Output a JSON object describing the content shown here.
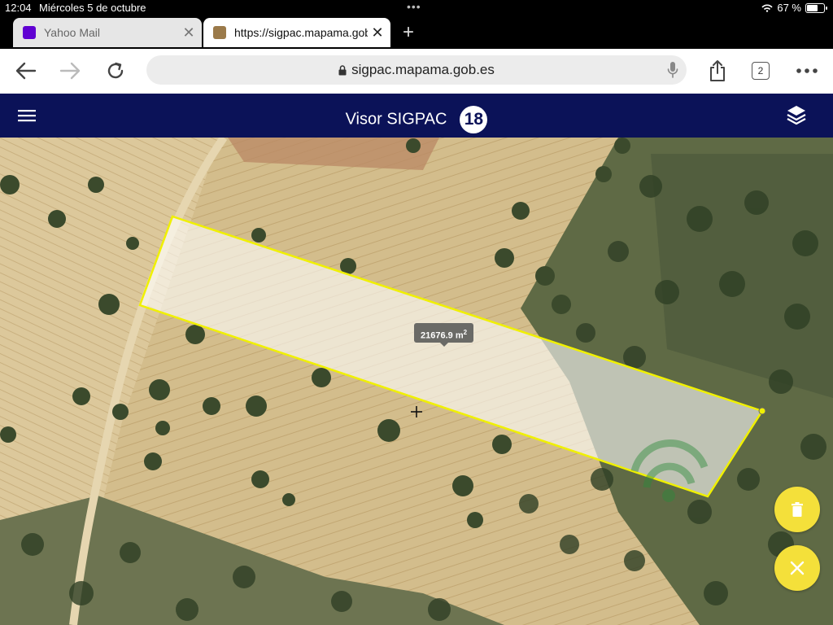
{
  "status": {
    "time": "12:04",
    "date": "Miércoles 5 de octubre",
    "battery_text": "67 %",
    "battery_level": 0.67
  },
  "tabs": [
    {
      "title": "Yahoo Mail",
      "active": false,
      "favicon_color": "#6001d2"
    },
    {
      "title": "https://sigpac.mapama.gob.es",
      "active": true,
      "favicon_color": "#9b7a4a"
    }
  ],
  "toolbar": {
    "url": "sigpac.mapama.gob.es",
    "tab_count": "2"
  },
  "app": {
    "title": "Visor SIGPAC",
    "zoom_level": "18",
    "header_color": "#0b1258"
  },
  "map": {
    "area_value": "21676.9 m",
    "area_unit_exp": "2",
    "polygon_color": "#f0f000",
    "fab_color": "#f4e03a"
  }
}
